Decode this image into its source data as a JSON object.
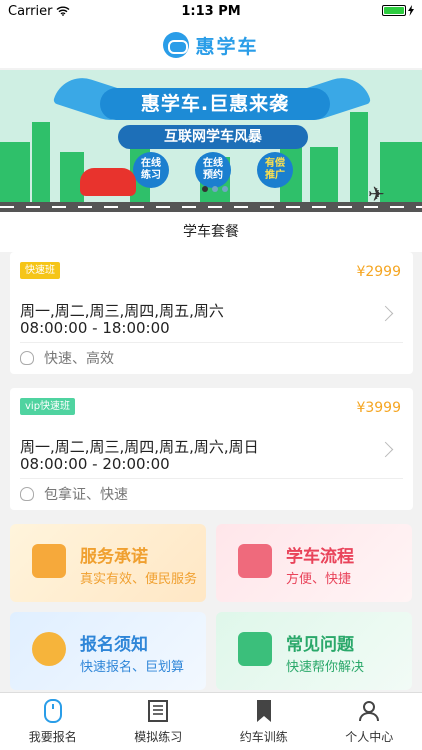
{
  "status_bar": {
    "carrier": "Carrier",
    "time": "1:13 PM"
  },
  "header": {
    "brand": "惠学车",
    "logo_icon": "steering-face-logo"
  },
  "banner": {
    "title": "惠学车.巨惠来袭",
    "subtitle": "互联网学车风暴",
    "bubbles": [
      {
        "line1": "在线",
        "line2": "练习"
      },
      {
        "line1": "在线",
        "line2": "预约"
      },
      {
        "line1": "有偿",
        "line2": "推广"
      }
    ]
  },
  "section_title": "学车套餐",
  "packages": [
    {
      "tag": "快速班",
      "tag_color": "#f5c518",
      "price": "¥2999",
      "days": "周一,周二,周三,周四,周五,周六",
      "hours": "08:00:00 - 18:00:00",
      "feature": "快速、高效"
    },
    {
      "tag": "vip快速班",
      "tag_color": "#4fd3a0",
      "price": "¥3999",
      "days": "周一,周二,周三,周四,周五,周六,周日",
      "hours": "08:00:00 - 20:00:00",
      "feature": "包拿证、快速"
    }
  ],
  "services": [
    {
      "title": "服务承诺",
      "subtitle": "真实有效、便民服务",
      "title_color": "#f0a030",
      "icon": "certificate-icon"
    },
    {
      "title": "学车流程",
      "subtitle": "方便、快捷",
      "title_color": "#e9435a",
      "icon": "document-flow-icon"
    },
    {
      "title": "报名须知",
      "subtitle": "快速报名、巨划算",
      "title_color": "#2f86d8",
      "icon": "info-icon"
    },
    {
      "title": "常见问题",
      "subtitle": "快速帮你解决",
      "title_color": "#2aa86a",
      "icon": "inbox-question-icon"
    }
  ],
  "tabs": [
    {
      "label": "我要报名",
      "icon": "mouse-icon",
      "active": true
    },
    {
      "label": "模拟练习",
      "icon": "document-icon"
    },
    {
      "label": "约车训练",
      "icon": "bookmark-icon"
    },
    {
      "label": "个人中心",
      "icon": "user-icon"
    }
  ],
  "colors": {
    "accent": "#2a9de8",
    "price": "#f5a623"
  }
}
